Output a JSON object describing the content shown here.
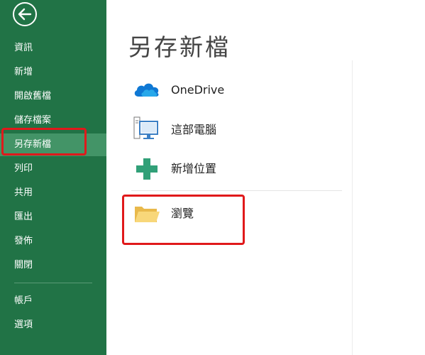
{
  "sidebar": {
    "back_icon": "back-arrow-icon",
    "items": [
      {
        "label": "資訊"
      },
      {
        "label": "新增"
      },
      {
        "label": "開啟舊檔"
      },
      {
        "label": "儲存檔案"
      },
      {
        "label": "另存新檔",
        "active": true
      },
      {
        "label": "列印"
      },
      {
        "label": "共用"
      },
      {
        "label": "匯出"
      },
      {
        "label": "發佈"
      },
      {
        "label": "關閉"
      },
      {
        "label": "帳戶"
      },
      {
        "label": "選項"
      }
    ]
  },
  "main": {
    "title": "另存新檔",
    "locations": [
      {
        "label": "OneDrive",
        "icon": "onedrive-cloud-icon"
      },
      {
        "label": "這部電腦",
        "icon": "computer-icon"
      },
      {
        "label": "新增位置",
        "icon": "plus-icon"
      }
    ],
    "browse": {
      "label": "瀏覽",
      "icon": "folder-icon"
    }
  },
  "colors": {
    "sidebar_bg": "#217346",
    "sidebar_active": "#439467",
    "highlight": "#e0191b",
    "onedrive": "#0f78d4",
    "plus": "#31a078",
    "folder": "#f8d77a"
  }
}
